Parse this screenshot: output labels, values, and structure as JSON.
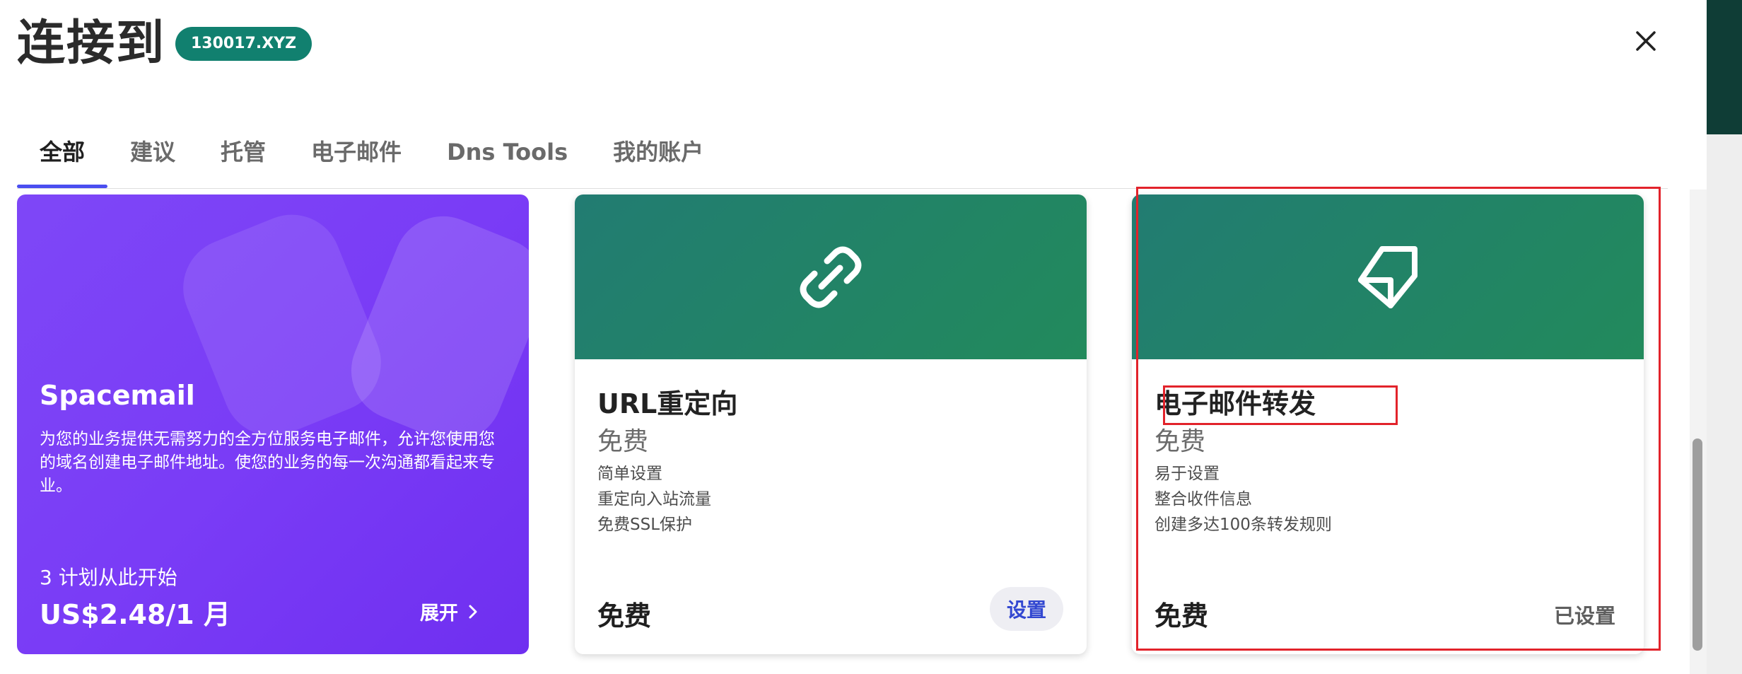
{
  "header": {
    "title": "连接到",
    "domain_badge": "130017.XYZ",
    "close_icon": "close-icon"
  },
  "tabs": [
    {
      "label": "全部",
      "active": true
    },
    {
      "label": "建议",
      "active": false
    },
    {
      "label": "托管",
      "active": false
    },
    {
      "label": "电子邮件",
      "active": false
    },
    {
      "label": "Dns Tools",
      "active": false
    },
    {
      "label": "我的账户",
      "active": false
    }
  ],
  "cards": {
    "promo": {
      "title": "Spacemail",
      "description": "为您的业务提供无需努力的全方位服务电子邮件，允许您使用您的域名创建电子邮件地址。使您的业务的每一次沟通都看起来专业。",
      "start_text": "3 计划从此开始",
      "price": "US$2.48/1 月",
      "expand_label": "展开",
      "expand_icon": "chevron-right-icon"
    },
    "url_redirect": {
      "icon": "link-icon",
      "title": "URL重定向",
      "price_sub": "免费",
      "features": [
        "简单设置",
        "重定向入站流量",
        "免费SSL保护"
      ],
      "price": "免费",
      "action_label": "设置"
    },
    "email_forward": {
      "icon": "note-icon",
      "title": "电子邮件转发",
      "price_sub": "免费",
      "features": [
        "易于设置",
        "整合收件信息",
        "创建多达100条转发规则"
      ],
      "price": "免费",
      "status_label": "已设置"
    }
  },
  "colors": {
    "accent_tab": "#4a4ef0",
    "badge": "#11806f",
    "promo_purple": "#7a3cf6",
    "banner_green": "#228a5c",
    "annotation_red": "#e2232b"
  }
}
